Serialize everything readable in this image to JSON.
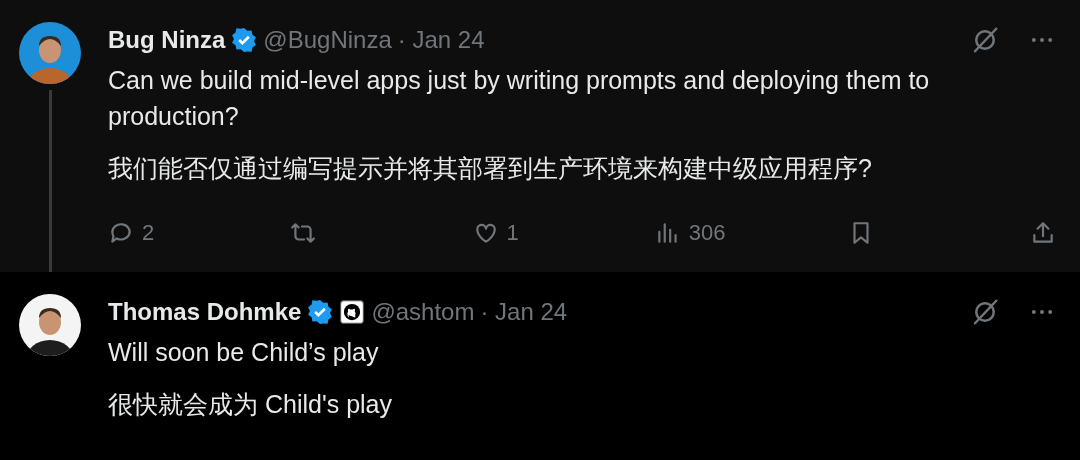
{
  "tweets": [
    {
      "name": "Bug Ninza",
      "verified": true,
      "affiliate": false,
      "handle": "@BugNinza",
      "date": "· Jan 24",
      "thread_line": true,
      "highlighted": true,
      "paragraphs": [
        "Can we build mid-level apps just by writing prompts and deploying them to production?",
        "我们能否仅通过编写提示并将其部署到生产环境来构建中级应用程序?"
      ],
      "actions": [
        {
          "kind": "reply",
          "count": "2"
        },
        {
          "kind": "repost"
        },
        {
          "kind": "like",
          "count": "1"
        },
        {
          "kind": "views",
          "count": "306"
        },
        {
          "kind": "bookmark"
        },
        {
          "kind": "share"
        }
      ]
    },
    {
      "name": "Thomas Dohmke",
      "verified": true,
      "affiliate": true,
      "handle": "@ashtom",
      "date": "· Jan 24",
      "thread_line": false,
      "highlighted": false,
      "paragraphs": [
        "Will soon be Child’s play",
        "很快就会成为 Child's play"
      ]
    }
  ]
}
